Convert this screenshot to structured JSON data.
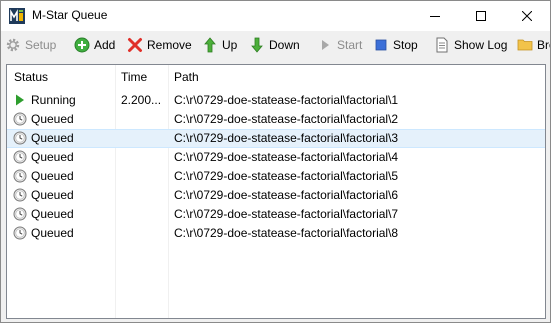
{
  "window": {
    "title": "M-Star Queue",
    "icon": "mstar-logo-icon"
  },
  "toolbar": {
    "setup": {
      "label": "Setup",
      "icon": "gear-icon",
      "enabled": false
    },
    "add": {
      "label": "Add",
      "icon": "plus-circle-icon",
      "enabled": true
    },
    "remove": {
      "label": "Remove",
      "icon": "red-x-icon",
      "enabled": true
    },
    "up": {
      "label": "Up",
      "icon": "arrow-up-icon",
      "enabled": true
    },
    "down": {
      "label": "Down",
      "icon": "arrow-down-icon",
      "enabled": true
    },
    "start": {
      "label": "Start",
      "icon": "play-icon",
      "enabled": false
    },
    "stop": {
      "label": "Stop",
      "icon": "stop-square-icon",
      "enabled": true
    },
    "show_log": {
      "label": "Show Log",
      "icon": "document-icon",
      "enabled": true
    },
    "browse": {
      "label": "Bro",
      "icon": "folder-icon",
      "enabled": true
    }
  },
  "table": {
    "columns": [
      "Status",
      "Time",
      "Path"
    ],
    "rows": [
      {
        "status": "Running",
        "time": "2.200...",
        "path": "C:\\r\\0729-doe-statease-factorial\\factorial\\1",
        "icon": "play-green-icon"
      },
      {
        "status": "Queued",
        "time": "",
        "path": "C:\\r\\0729-doe-statease-factorial\\factorial\\2",
        "icon": "clock-icon"
      },
      {
        "status": "Queued",
        "time": "",
        "path": "C:\\r\\0729-doe-statease-factorial\\factorial\\3",
        "icon": "clock-icon",
        "selected": true
      },
      {
        "status": "Queued",
        "time": "",
        "path": "C:\\r\\0729-doe-statease-factorial\\factorial\\4",
        "icon": "clock-icon"
      },
      {
        "status": "Queued",
        "time": "",
        "path": "C:\\r\\0729-doe-statease-factorial\\factorial\\5",
        "icon": "clock-icon"
      },
      {
        "status": "Queued",
        "time": "",
        "path": "C:\\r\\0729-doe-statease-factorial\\factorial\\6",
        "icon": "clock-icon"
      },
      {
        "status": "Queued",
        "time": "",
        "path": "C:\\r\\0729-doe-statease-factorial\\factorial\\7",
        "icon": "clock-icon"
      },
      {
        "status": "Queued",
        "time": "",
        "path": "C:\\r\\0729-doe-statease-factorial\\factorial\\8",
        "icon": "clock-icon"
      }
    ]
  },
  "colors": {
    "selected_row": "#e5f1fb",
    "running_green": "#2e9e2e",
    "remove_red": "#e0302a",
    "stop_blue": "#3b6fd8"
  }
}
